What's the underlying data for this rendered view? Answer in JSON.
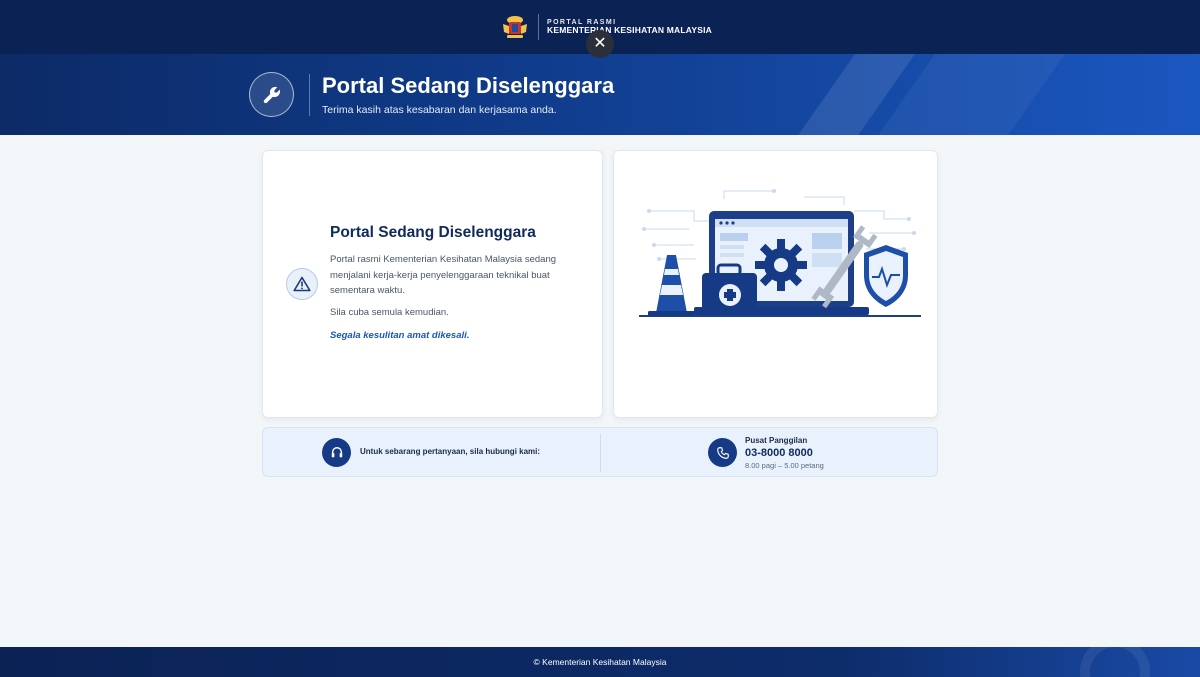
{
  "header": {
    "brand_small": "PORTAL RASMI",
    "brand_name": "KEMENTERIAN KESIHATAN MALAYSIA",
    "close_symbol": "✕"
  },
  "hero": {
    "title": "Portal Sedang Diselenggara",
    "subtitle": "Terima kasih atas kesabaran dan kerjasama anda.",
    "icon": "wrench-icon"
  },
  "message": {
    "title": "Portal Sedang Diselenggara",
    "body": "Portal rasmi Kementerian Kesihatan Malaysia sedang menjalani kerja-kerja penyelenggaraan teknikal buat sementara waktu.",
    "retry": "Sila cuba semula kemudian.",
    "apology": "Segala kesulitan amat dikesali.",
    "icon": "warning-icon"
  },
  "contact": {
    "prompt": "Untuk sebarang pertanyaan, sila hubungi kami:",
    "call_label": "Pusat Panggilan",
    "call_number": "03-8000 8000",
    "call_hours": "8.00 pagi – 5.00 petang"
  },
  "footer": {
    "copyright": "© Kementerian Kesihatan Malaysia"
  },
  "colors": {
    "navy": "#0b2255",
    "primary": "#163a85",
    "accent": "#1d56b8",
    "background": "#f3f6f9"
  }
}
